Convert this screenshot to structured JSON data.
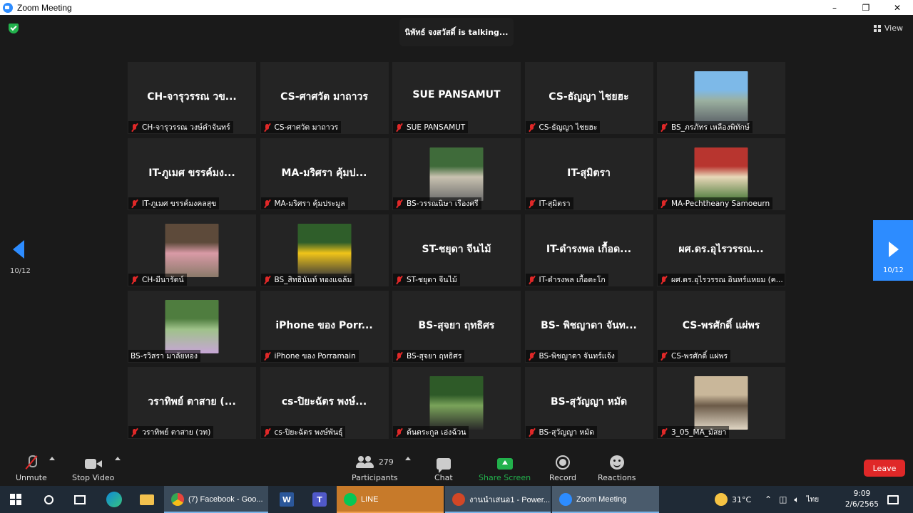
{
  "window": {
    "title": "Zoom Meeting",
    "controls": [
      "–",
      "❐",
      "✕"
    ]
  },
  "meeting": {
    "talking_text": "นิพัทธ์ จงสวัสดิ์ is talking...",
    "view_label": "View",
    "page_indicator": "10/12",
    "tiles": [
      {
        "big": "CH-จารุวรรณ วข...",
        "name": "CH-จารุวรรณ วงษ์คำจันทร์",
        "photo": false
      },
      {
        "big": "CS-ศาศวัต มาถาวร",
        "name": "CS-ศาศวัต มาถาวร",
        "photo": false
      },
      {
        "big": "SUE    PANSAMUT",
        "name": "SUE    PANSAMUT",
        "photo": false
      },
      {
        "big": "CS-ธัญญา ไชยฮะ",
        "name": "CS-ธัญญา ไชยฮะ",
        "photo": false
      },
      {
        "big": "",
        "name": "BS_ภรภัทร เหลืองพิทักษ์",
        "photo": true,
        "photo_colors": [
          "#7db9e8",
          "#9bb0a0",
          "#5a5f66"
        ]
      },
      {
        "big": "IT-ภูเมศ ขรรค์มง...",
        "name": "IT-ภูเมศ ขรรค์มงคลสุข",
        "photo": false
      },
      {
        "big": "MA-มริศรา คุ้มป...",
        "name": "MA-มริศรา คุ้มประมูล",
        "photo": false
      },
      {
        "big": "",
        "name": "BS-วรรณนิษา เรืองศรี",
        "photo": true,
        "photo_colors": [
          "#3f6b3a",
          "#c9c2b0",
          "#6d6d6d"
        ]
      },
      {
        "big": "IT-สุมิตรา",
        "name": "IT-สุมิตรา",
        "photo": false
      },
      {
        "big": "",
        "name": "MA-Pechtheany Samoeurn",
        "photo": true,
        "photo_colors": [
          "#b8352f",
          "#e8d7b8",
          "#4a7a3a"
        ]
      },
      {
        "big": "",
        "name": "CH-มีนารัตน์",
        "photo": true,
        "photo_colors": [
          "#5d4a3a",
          "#d99aa6",
          "#8a7a6a"
        ]
      },
      {
        "big": "",
        "name": "BS_สิทธินันท์ ทองแฉล้ม",
        "photo": true,
        "photo_colors": [
          "#2f5e2a",
          "#f0c419",
          "#3a3a3a"
        ]
      },
      {
        "big": "ST-ชยุดา จีนไม้",
        "name": "ST-ชยุดา จีนไม้",
        "photo": false
      },
      {
        "big": "IT-ดำรงพล เกื้อด...",
        "name": "IT-ดำรงพล เกื้อตะโก",
        "photo": false
      },
      {
        "big": "ผศ.ดร.อุไรวรรณ...",
        "name": "ผศ.ดร.อุไรวรรณ อินทร์แหยม (ค...",
        "photo": false
      },
      {
        "big": "",
        "name": "BS-รวิสรา มาลัยทอง",
        "photo": true,
        "photo_colors": [
          "#4f7d3f",
          "#9fc28a",
          "#c7a6d6"
        ],
        "muted": false
      },
      {
        "big": "iPhone ของ Porr...",
        "name": "iPhone ของ Porramain",
        "photo": false
      },
      {
        "big": "BS-สุจยา ฤทธิศร",
        "name": "BS-สุจยา ฤทธิศร",
        "photo": false
      },
      {
        "big": "BS- พิชญาดา จันท...",
        "name": "BS-พิชญาดา จันทร์แจ้ง",
        "photo": false
      },
      {
        "big": "CS-พรศักดิ์ แผ่พร",
        "name": "CS-พรศักดิ์ แผ่พร",
        "photo": false
      },
      {
        "big": "วราทิพย์  ตาสาย (...",
        "name": "วราทิพย์  ตาสาย (วท)",
        "photo": false
      },
      {
        "big": "cs-ปิยะฉัตร พงษ์...",
        "name": "cs-ปิยะฉัตร พงษ์พันธุ์",
        "photo": false
      },
      {
        "big": "",
        "name": "ต้นตระกูล เอ่งฉ้วน",
        "photo": true,
        "photo_colors": [
          "#2e5a28",
          "#7aa35a",
          "#2a2a2a"
        ]
      },
      {
        "big": "BS-สุวัญญา หมัด",
        "name": "BS-สุวัญญา หมัด",
        "photo": false
      },
      {
        "big": "",
        "name": "3_05_MA_มัสยา",
        "photo": true,
        "photo_colors": [
          "#c9b79a",
          "#6b5a48",
          "#e0d6c4"
        ]
      }
    ]
  },
  "toolbar": {
    "unmute": "Unmute",
    "stop_video": "Stop Video",
    "participants": "Participants",
    "participants_count": "279",
    "chat": "Chat",
    "share_screen": "Share Screen",
    "record": "Record",
    "reactions": "Reactions",
    "leave": "Leave"
  },
  "taskbar": {
    "apps": [
      {
        "label": "(7) Facebook - Goo...",
        "color": "#e8453c"
      },
      {
        "label": "LINE",
        "color": "#06c755"
      },
      {
        "label": "งานนำเสนอ1 - Power...",
        "color": "#d24726"
      },
      {
        "label": "Zoom Meeting",
        "color": "#2d8cff"
      }
    ],
    "temperature": "31°C",
    "language": "ไทย",
    "time": "9:09",
    "date": "2/6/2565"
  },
  "colors": {
    "accent": "#2d8cff",
    "leave": "#e02828",
    "share": "#22b14c",
    "muted": "#e02828"
  }
}
